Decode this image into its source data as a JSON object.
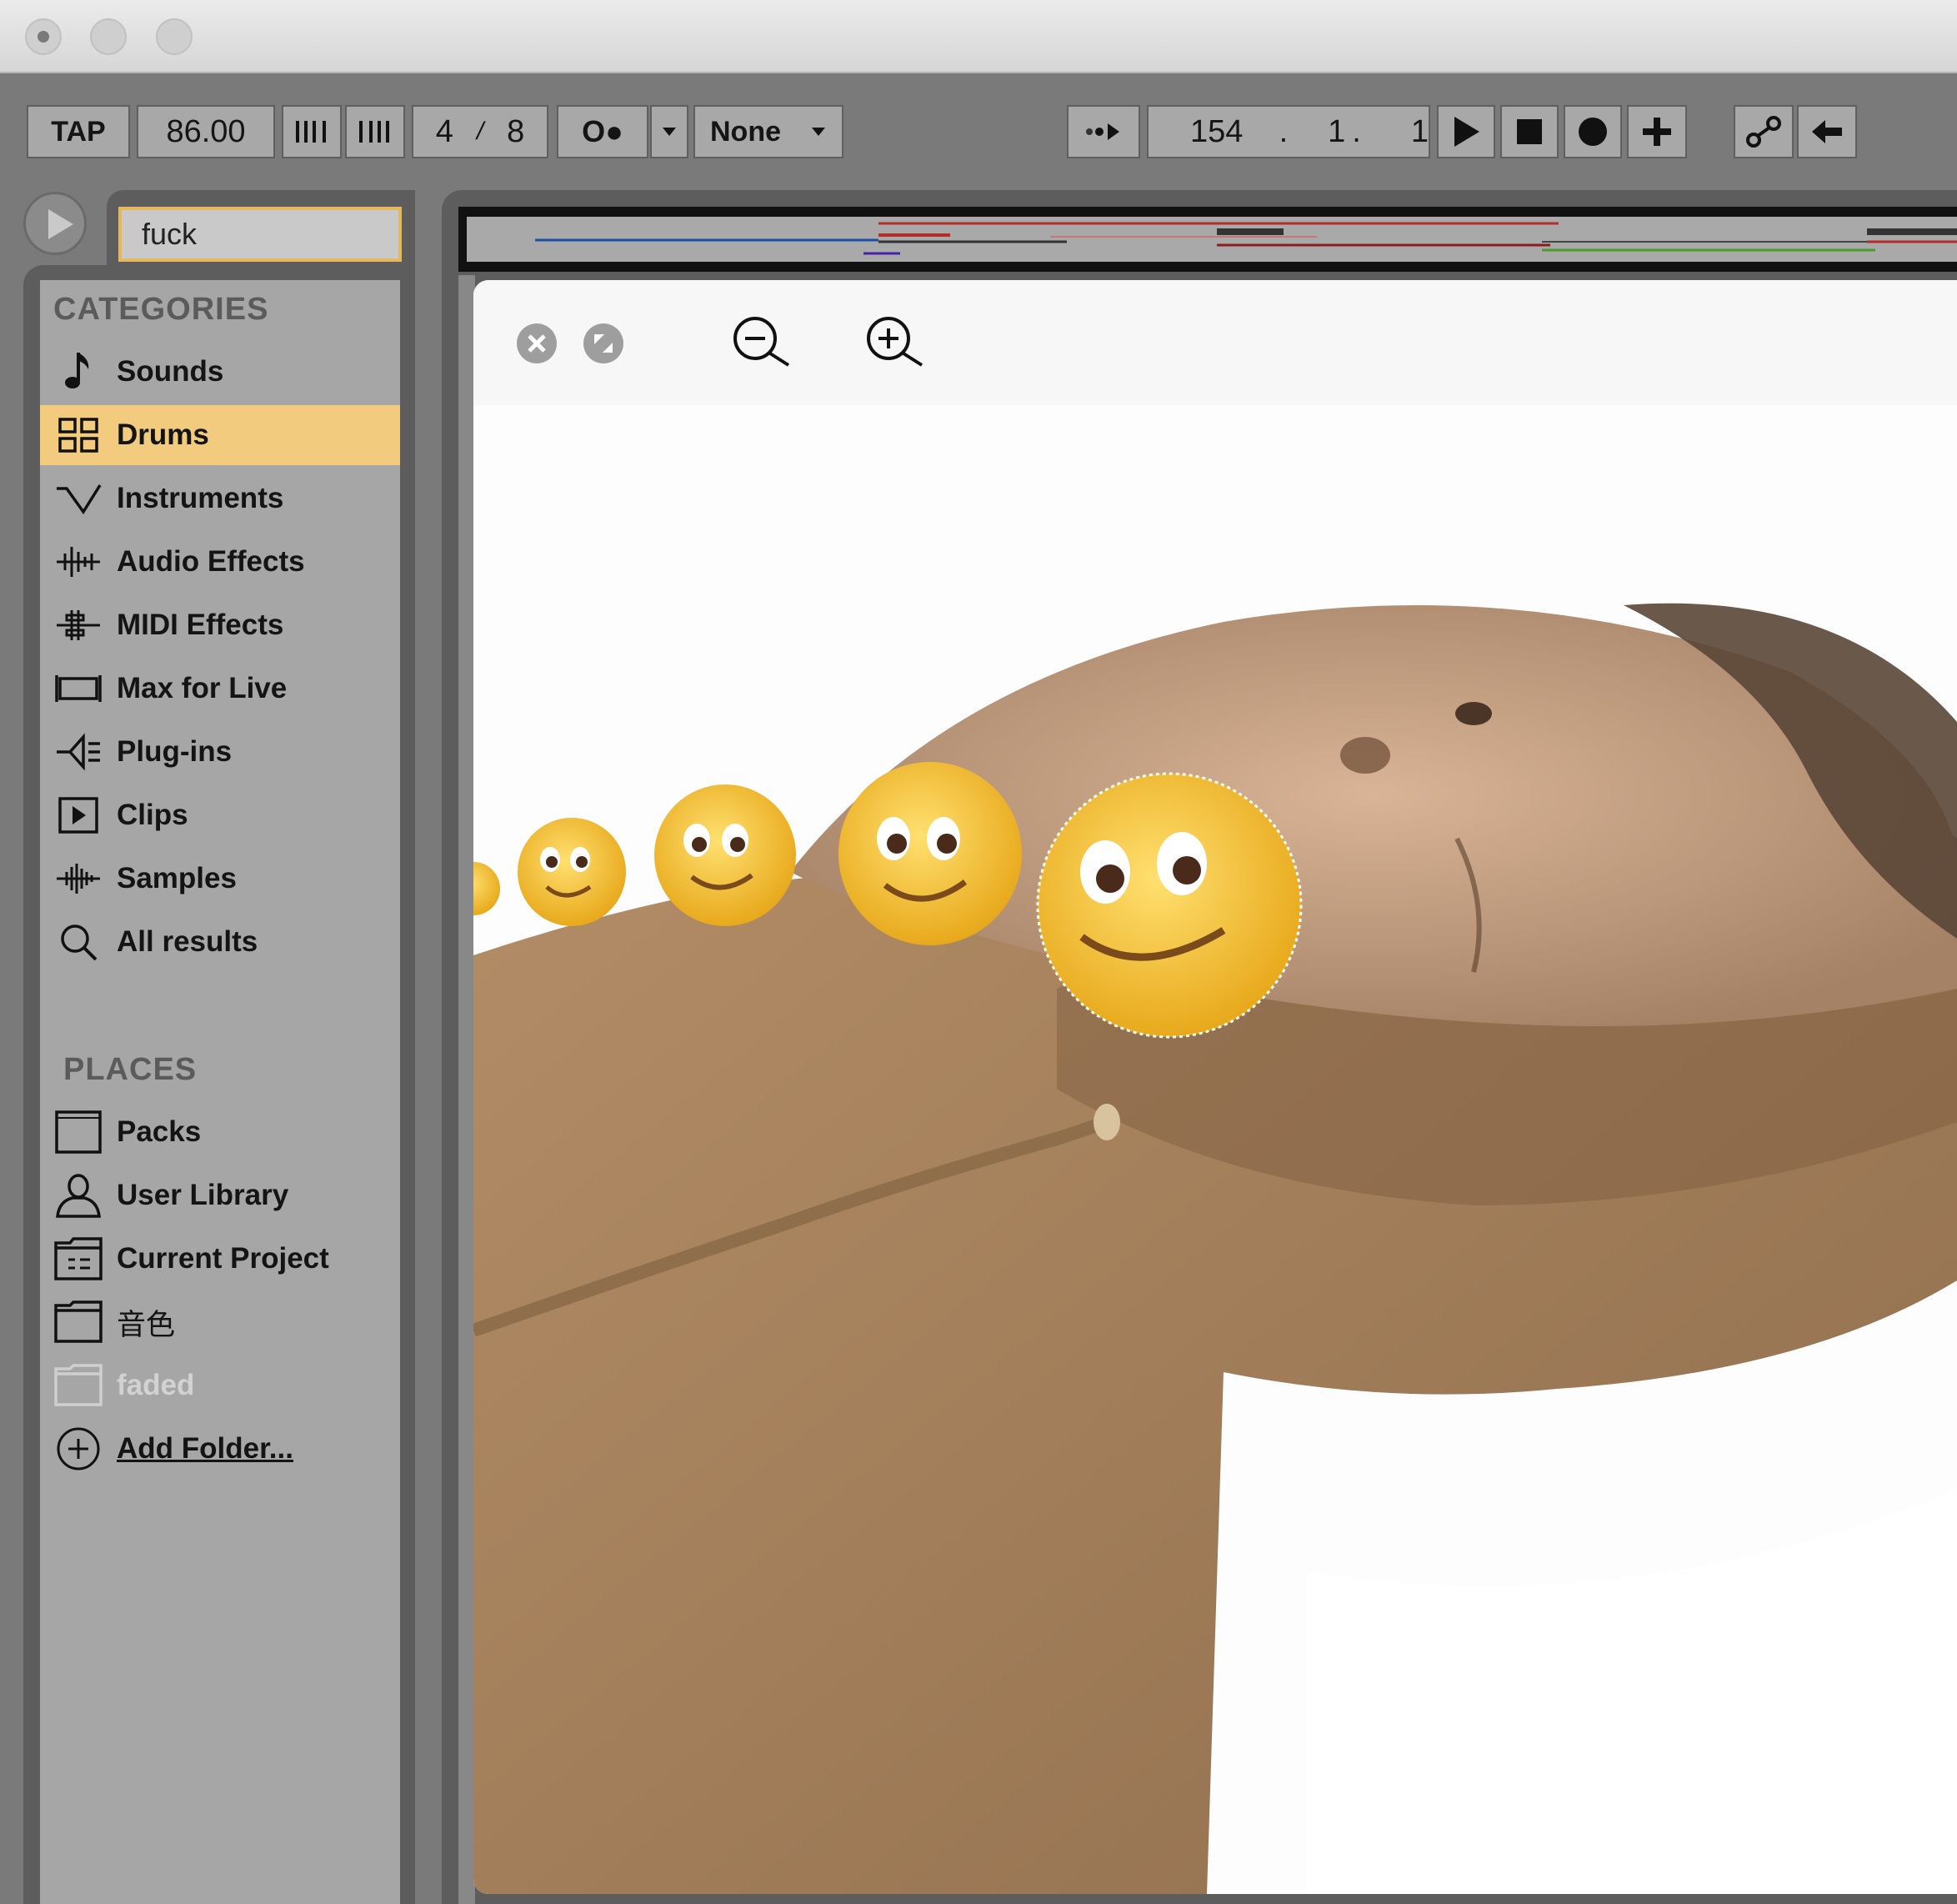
{
  "titlebar": {
    "buttons": [
      "close",
      "minimize",
      "zoom"
    ]
  },
  "transport": {
    "tap_label": "TAP",
    "tempo": "86.00",
    "time_sig_num": "4",
    "time_sig_sep": "/",
    "time_sig_den": "8",
    "metronome_label": "O●",
    "quantize": "None",
    "position_bar": "154",
    "position_beat": "1",
    "position_sixteenth": "1"
  },
  "browser": {
    "search_value": "fuck",
    "categories_title": "CATEGORIES",
    "categories": [
      {
        "label": "Sounds",
        "icon": "note-icon"
      },
      {
        "label": "Drums",
        "icon": "grid-icon",
        "selected": true
      },
      {
        "label": "Instruments",
        "icon": "wave-icon"
      },
      {
        "label": "Audio Effects",
        "icon": "audio-effect-icon"
      },
      {
        "label": "MIDI Effects",
        "icon": "midi-effect-icon"
      },
      {
        "label": "Max for Live",
        "icon": "max-icon"
      },
      {
        "label": "Plug-ins",
        "icon": "plug-icon"
      },
      {
        "label": "Clips",
        "icon": "clip-icon"
      },
      {
        "label": "Samples",
        "icon": "sample-icon"
      },
      {
        "label": "All results",
        "icon": "search-icon"
      }
    ],
    "places_title": "PLACES",
    "places": [
      {
        "label": "Packs",
        "icon": "packs-icon"
      },
      {
        "label": "User Library",
        "icon": "user-icon"
      },
      {
        "label": "Current Project",
        "icon": "project-icon"
      },
      {
        "label": "音色",
        "icon": "folder-icon"
      },
      {
        "label": "faded",
        "icon": "folder-icon",
        "dim": true
      },
      {
        "label": "Add Folder...",
        "icon": "add-icon",
        "underline": true
      }
    ]
  },
  "colors": {
    "accent": "#f2cb7e",
    "search_border": "#e6b85d",
    "panel": "#a6a6a6"
  }
}
